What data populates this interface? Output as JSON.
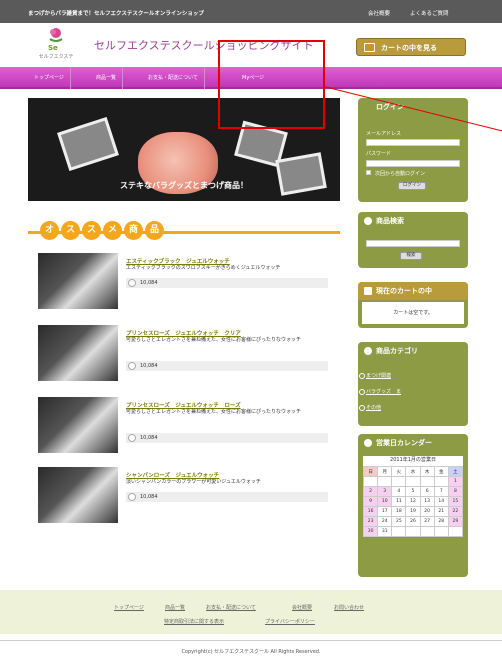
{
  "topbar": {
    "tagline": "まつげからパラ雑貨まで！セルフエクステスクールオンラインショップ",
    "links": [
      "会社概要",
      "よくあるご質問"
    ]
  },
  "header": {
    "logo_text": "セルフエクステ",
    "site_name": "セルフエクステスクールショッピングサイト",
    "cart_button": "カートの中を見る"
  },
  "nav": [
    "トップページ",
    "商品一覧",
    "お支払・配送について",
    "Myページ"
  ],
  "hero": {
    "caption": "ステキなバラグッズとまつげ商品！"
  },
  "recommend": {
    "title": [
      "オ",
      "ス",
      "ス",
      "メ",
      "商",
      "品"
    ]
  },
  "products": [
    {
      "name": "エスティックブラック　ジュエルウォッチ",
      "desc": "エスティックブラックのスワロフスキーがきらめくジュエルウォッチ",
      "price": "10,084"
    },
    {
      "name": "プリンセスローズ　ジュエルウォッチ　クリア",
      "desc": "可愛らしさとエレガントさを兼ね備えた、女性にお客様にぴったりなウォッチ",
      "price": "10,084"
    },
    {
      "name": "プリンセスローズ　ジュエルウォッチ　ローズ",
      "desc": "可愛らしさとエレガントさを兼ね備えた、女性にお客様にぴったりなウォッチ",
      "price": "10,084"
    },
    {
      "name": "シャンパンローズ　ジュエルウォッチ",
      "desc": "淡いシャンパンカラーのフラワーが可愛いジュエルウォッチ",
      "price": "10,084"
    }
  ],
  "login": {
    "title": "ログイン",
    "email_label": "メールアドレス",
    "password_label": "パスワード",
    "auto_login": "次回から自動ログイン",
    "button": "ログイン"
  },
  "search": {
    "title": "商品検索",
    "button": "検索"
  },
  "cart": {
    "title": "現在のカートの中",
    "empty": "カートは空です。"
  },
  "category": {
    "title": "商品カテゴリ",
    "items": [
      "まつげ関連",
      "バラグッズ　ま",
      "その他"
    ]
  },
  "calendar": {
    "title": "営業日カレンダー",
    "month": "2011年1月の営業日",
    "weekdays": [
      "日",
      "月",
      "火",
      "水",
      "木",
      "金",
      "土"
    ],
    "weeks": [
      [
        "",
        "",
        "",
        "",
        "",
        "",
        "1"
      ],
      [
        "2",
        "3",
        "4",
        "5",
        "6",
        "7",
        "8"
      ],
      [
        "9",
        "10",
        "11",
        "12",
        "13",
        "14",
        "15"
      ],
      [
        "16",
        "17",
        "18",
        "19",
        "20",
        "21",
        "22"
      ],
      [
        "23",
        "24",
        "25",
        "26",
        "27",
        "28",
        "29"
      ],
      [
        "30",
        "31",
        "",
        "",
        "",
        "",
        ""
      ]
    ]
  },
  "footer": {
    "links_row1": [
      "トップページ",
      "商品一覧",
      "お支払・配送について",
      "会社概要",
      "お問い合わせ"
    ],
    "links_row2": [
      "特定商取引法に関する表示",
      "プライバシーポリシー"
    ],
    "copyright": "Copyright(c) セルフエクステスクール All Rights Reserved."
  },
  "colors": {
    "accent": "#c038b6",
    "sidebar": "#8c9b44",
    "orange": "#f4a71c",
    "gold": "#b99a3c"
  }
}
